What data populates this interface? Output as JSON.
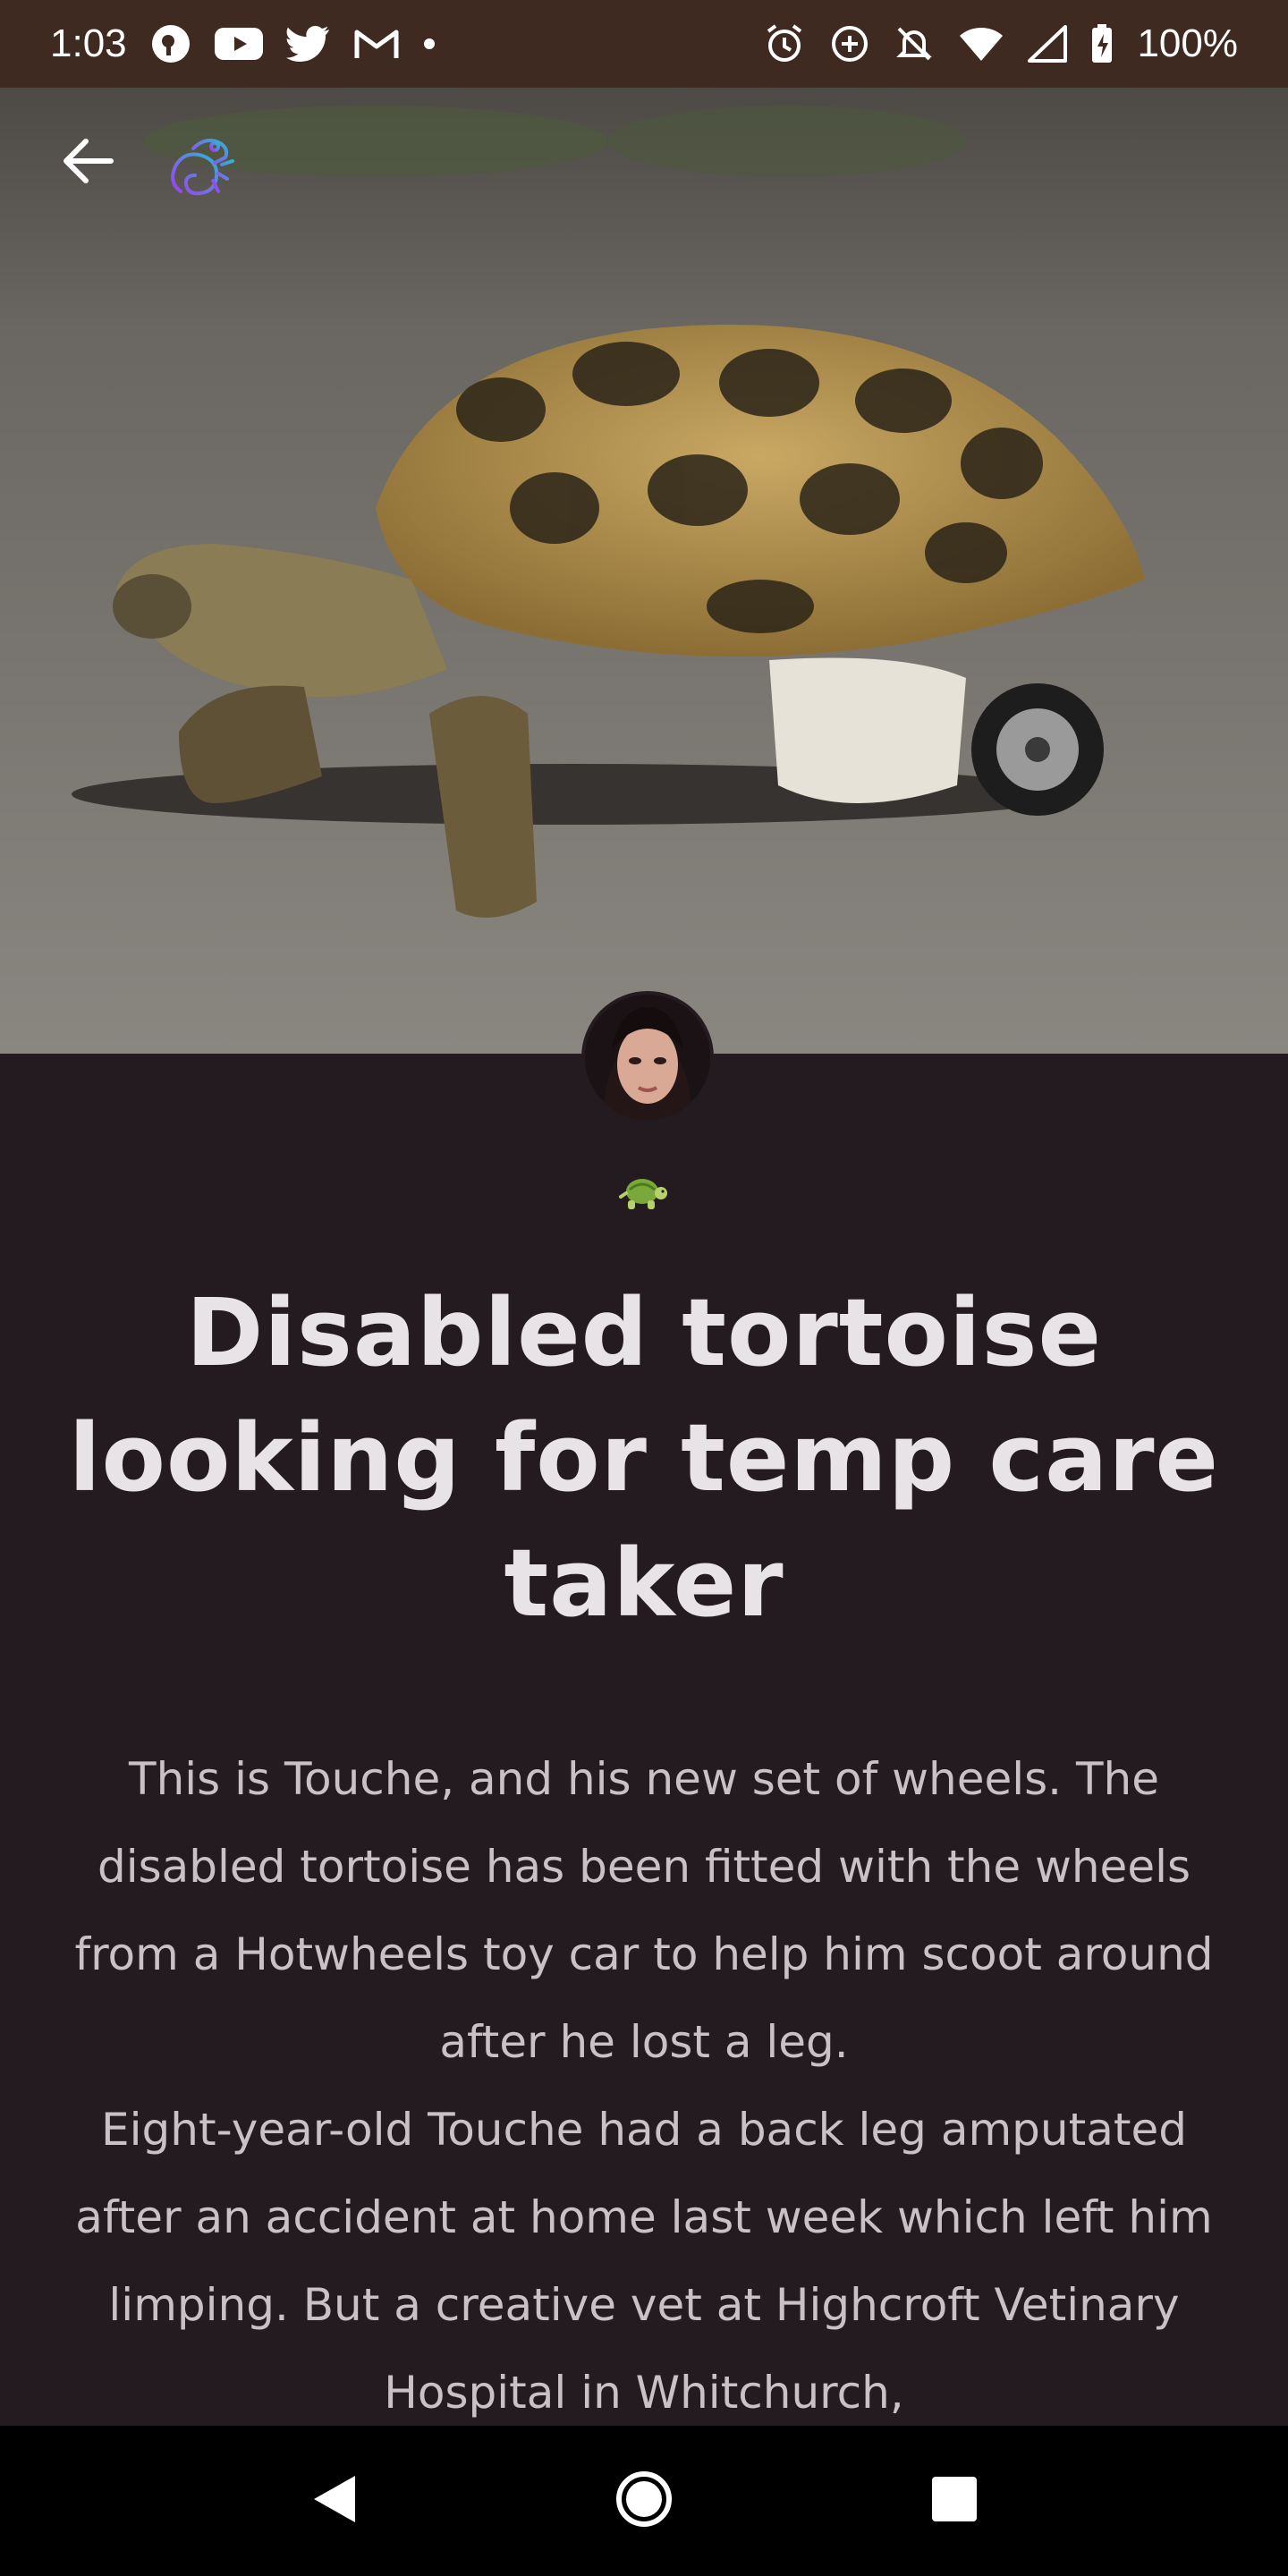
{
  "status_bar": {
    "time": "1:03",
    "battery": "100%",
    "left_icons": [
      "podcast-icon",
      "youtube-icon",
      "twitter-icon",
      "gmail-icon",
      "dot-icon"
    ],
    "right_icons": [
      "alarm-icon",
      "data-saver-icon",
      "bell-off-icon",
      "wifi-icon",
      "signal-icon",
      "battery-charging-icon"
    ]
  },
  "header": {
    "back_icon": "arrow-left-icon",
    "logo_icon": "chameleon-logo-icon"
  },
  "post": {
    "hero_image": "tortoise-with-wheels-photo",
    "author_avatar": "author-avatar-photo",
    "category_emoji": "🐢",
    "title": "Disabled tortoise looking for temp care taker",
    "paragraphs": [
      "This is Touche, and his new set of wheels. The disabled tortoise has been fitted with the wheels from a Hotwheels toy car to help him scoot around after he lost a leg.",
      "Eight-year-old Touche had a back leg amputated after an accident at home last week which left him limping. But a creative vet at Highcroft Vetinary Hospital in Whitchurch,"
    ]
  },
  "nav_bar": {
    "back_icon": "triangle-back-icon",
    "home_icon": "circle-home-icon",
    "recents_icon": "square-recents-icon"
  },
  "colors": {
    "status_bar_bg": "#3e2a20",
    "page_bg": "#241b20",
    "title_color": "#e8e3e6",
    "body_color": "#c9c1c5",
    "nav_bar_bg": "#000000"
  }
}
